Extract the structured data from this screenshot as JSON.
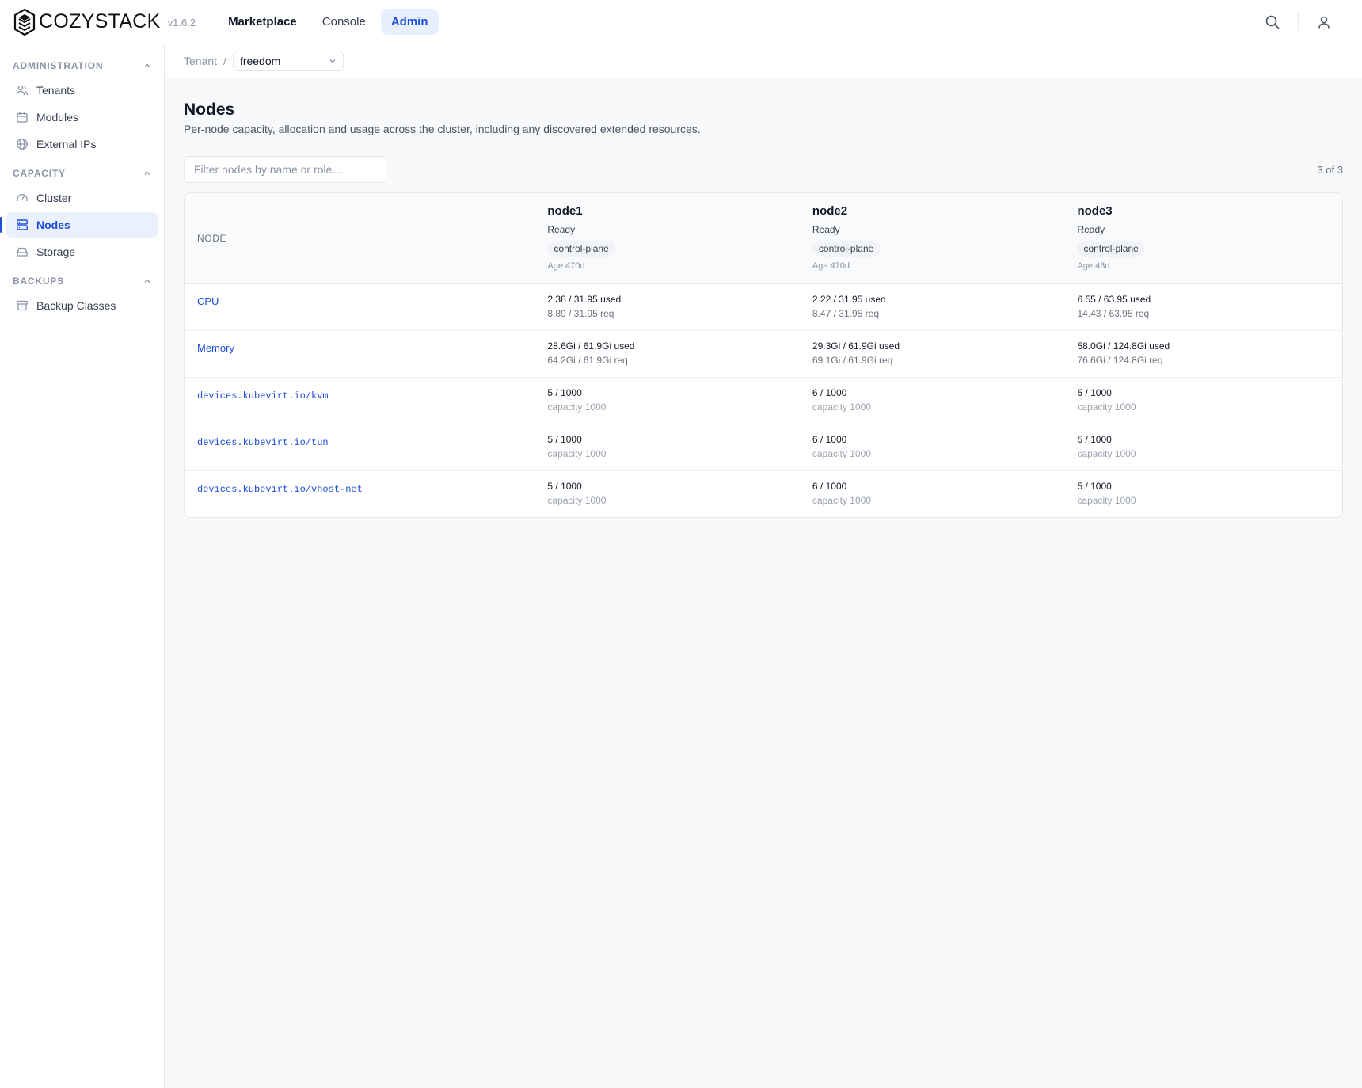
{
  "brand": {
    "name": "COZYSTACK",
    "version": "v1.6.2"
  },
  "topnav": {
    "marketplace": "Marketplace",
    "console": "Console",
    "admin": "Admin"
  },
  "sidebar": {
    "administration": {
      "title": "ADMINISTRATION",
      "items": [
        {
          "label": "Tenants",
          "icon": "users-icon"
        },
        {
          "label": "Modules",
          "icon": "calendar-icon"
        },
        {
          "label": "External IPs",
          "icon": "globe-icon"
        }
      ]
    },
    "capacity": {
      "title": "CAPACITY",
      "items": [
        {
          "label": "Cluster",
          "icon": "gauge-icon"
        },
        {
          "label": "Nodes",
          "icon": "server-icon"
        },
        {
          "label": "Storage",
          "icon": "drive-icon"
        }
      ]
    },
    "backups": {
      "title": "BACKUPS",
      "items": [
        {
          "label": "Backup Classes",
          "icon": "archive-icon"
        }
      ]
    }
  },
  "breadcrumb": {
    "tenant_label": "Tenant",
    "separator": "/",
    "tenant_value": "freedom"
  },
  "page": {
    "title": "Nodes",
    "subtitle": "Per-node capacity, allocation and usage across the cluster, including any discovered extended resources.",
    "filter_placeholder": "Filter nodes by name or role…",
    "count": "3 of 3"
  },
  "table": {
    "header_label": "NODE",
    "nodes": [
      {
        "name": "node1",
        "status": "Ready",
        "role": "control-plane",
        "age": "Age 470d"
      },
      {
        "name": "node2",
        "status": "Ready",
        "role": "control-plane",
        "age": "Age 470d"
      },
      {
        "name": "node3",
        "status": "Ready",
        "role": "control-plane",
        "age": "Age 43d"
      }
    ],
    "rows": [
      {
        "resource": "CPU",
        "mono": false,
        "cells": [
          {
            "main": "2.38 / 31.95 used",
            "sub": "8.89 / 31.95 req"
          },
          {
            "main": "2.22 / 31.95 used",
            "sub": "8.47 / 31.95 req"
          },
          {
            "main": "6.55 / 63.95 used",
            "sub": "14.43 / 63.95 req"
          }
        ]
      },
      {
        "resource": "Memory",
        "mono": false,
        "cells": [
          {
            "main": "28.6Gi / 61.9Gi used",
            "sub": "64.2Gi / 61.9Gi req"
          },
          {
            "main": "29.3Gi / 61.9Gi used",
            "sub": "69.1Gi / 61.9Gi req"
          },
          {
            "main": "58.0Gi / 124.8Gi used",
            "sub": "76.6Gi / 124.8Gi req"
          }
        ]
      },
      {
        "resource": "devices.kubevirt.io/kvm",
        "mono": true,
        "cells": [
          {
            "main": "5 / 1000",
            "sub": "capacity 1000"
          },
          {
            "main": "6 / 1000",
            "sub": "capacity 1000"
          },
          {
            "main": "5 / 1000",
            "sub": "capacity 1000"
          }
        ]
      },
      {
        "resource": "devices.kubevirt.io/tun",
        "mono": true,
        "cells": [
          {
            "main": "5 / 1000",
            "sub": "capacity 1000"
          },
          {
            "main": "6 / 1000",
            "sub": "capacity 1000"
          },
          {
            "main": "5 / 1000",
            "sub": "capacity 1000"
          }
        ]
      },
      {
        "resource": "devices.kubevirt.io/vhost-net",
        "mono": true,
        "cells": [
          {
            "main": "5 / 1000",
            "sub": "capacity 1000"
          },
          {
            "main": "6 / 1000",
            "sub": "capacity 1000"
          },
          {
            "main": "5 / 1000",
            "sub": "capacity 1000"
          }
        ]
      }
    ]
  },
  "colors": {
    "accent": "#1d4ed8",
    "accent_bg": "#e8f0fe",
    "muted": "#8a94a6",
    "border": "#e5e7eb"
  }
}
